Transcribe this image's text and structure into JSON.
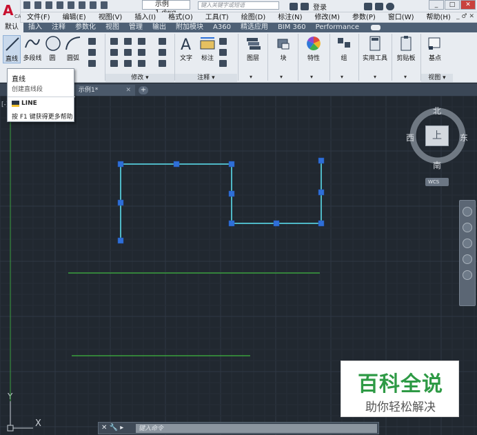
{
  "app": {
    "logo_letter": "A",
    "logo_sub": "CAD",
    "document_title": "示例1.dwg",
    "search_placeholder": "键入关键字或短语",
    "login_label": "登录",
    "window_controls": [
      "_",
      "□",
      "✕"
    ]
  },
  "menubar": {
    "items": [
      "文件(F)",
      "编辑(E)",
      "视图(V)",
      "插入(I)",
      "格式(O)",
      "工具(T)",
      "绘图(D)",
      "标注(N)",
      "修改(M)",
      "参数(P)",
      "窗口(W)",
      "帮助(H)"
    ],
    "right_controls": "_ ♂ ✕"
  },
  "ribbon_tabs": {
    "active": "默认",
    "items": [
      "默认",
      "插入",
      "注释",
      "参数化",
      "视图",
      "管理",
      "输出",
      "附加模块",
      "A360",
      "精选应用",
      "BIM 360",
      "Performance"
    ]
  },
  "ribbon": {
    "draw": {
      "line": "直线",
      "polyline": "多段线",
      "circle": "圆",
      "arc": "圆弧"
    },
    "modify_title": "修改 ▾",
    "annotation": {
      "text": "文字",
      "dimension": "标注",
      "title": "注释 ▾"
    },
    "layers": "图层",
    "block": "块",
    "properties": "特性",
    "group": "组",
    "utilities": "实用工具",
    "clipboard": "剪贴板",
    "base": "基点",
    "view_title": "视图 ▾"
  },
  "tooltip": {
    "title": "直线",
    "description": "创建直线段",
    "command": "LINE",
    "help": "按 F1 键获得更多帮助"
  },
  "file_tab": {
    "name": "示例1*",
    "close": "✕",
    "add": "+"
  },
  "canvas": {
    "viewport_label": "[-]",
    "ucs_x": "X",
    "ucs_y": "Y"
  },
  "viewcube": {
    "north": "北",
    "south": "南",
    "east": "东",
    "west": "西",
    "face": "上",
    "wcs": "WCS"
  },
  "command_line": {
    "controls": "✕  🔧  ▸",
    "placeholder": "键入命令"
  },
  "watermark": {
    "title": "百科全说",
    "subtitle": "助你轻松解决"
  },
  "colors": {
    "canvas_bg": "#212830",
    "polyline": "#4fb8c6",
    "grip": "#2f6fd8",
    "green_line": "#3fb93f",
    "ribbon_bg": "#e8ecf1",
    "ribbon_tabs_bg": "#4e6075"
  }
}
